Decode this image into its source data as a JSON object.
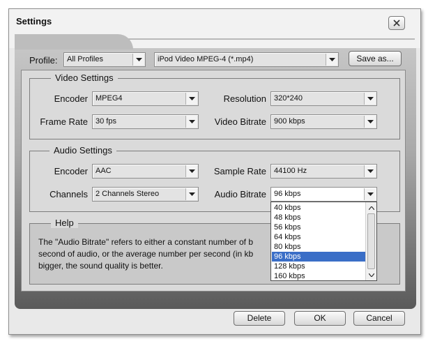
{
  "window": {
    "title": "Settings"
  },
  "profile": {
    "label": "Profile:",
    "category": "All Profiles",
    "preset": "iPod Video MPEG-4 (*.mp4)",
    "save_as": "Save as..."
  },
  "video": {
    "title": "Video Settings",
    "encoder_label": "Encoder",
    "encoder_value": "MPEG4",
    "resolution_label": "Resolution",
    "resolution_value": "320*240",
    "frame_rate_label": "Frame Rate",
    "frame_rate_value": "30 fps",
    "bitrate_label": "Video Bitrate",
    "bitrate_value": "900 kbps"
  },
  "audio": {
    "title": "Audio Settings",
    "encoder_label": "Encoder",
    "encoder_value": "AAC",
    "sample_rate_label": "Sample Rate",
    "sample_rate_value": "44100 Hz",
    "channels_label": "Channels",
    "channels_value": "2 Channels Stereo",
    "bitrate_label": "Audio Bitrate",
    "bitrate_value": "96 kbps"
  },
  "bitrate_options": [
    "40 kbps",
    "48 kbps",
    "56 kbps",
    "64 kbps",
    "80 kbps",
    "96 kbps",
    "128 kbps",
    "160 kbps"
  ],
  "bitrate_selected_index": 5,
  "help": {
    "title": "Help",
    "line1": "The \"Audio Bitrate\" refers to either a constant number of b",
    "line2": "second of audio, or the average number per second (in kb",
    "line3": "bigger, the sound quality is better."
  },
  "buttons": {
    "delete": "Delete",
    "ok": "OK",
    "cancel": "Cancel"
  }
}
